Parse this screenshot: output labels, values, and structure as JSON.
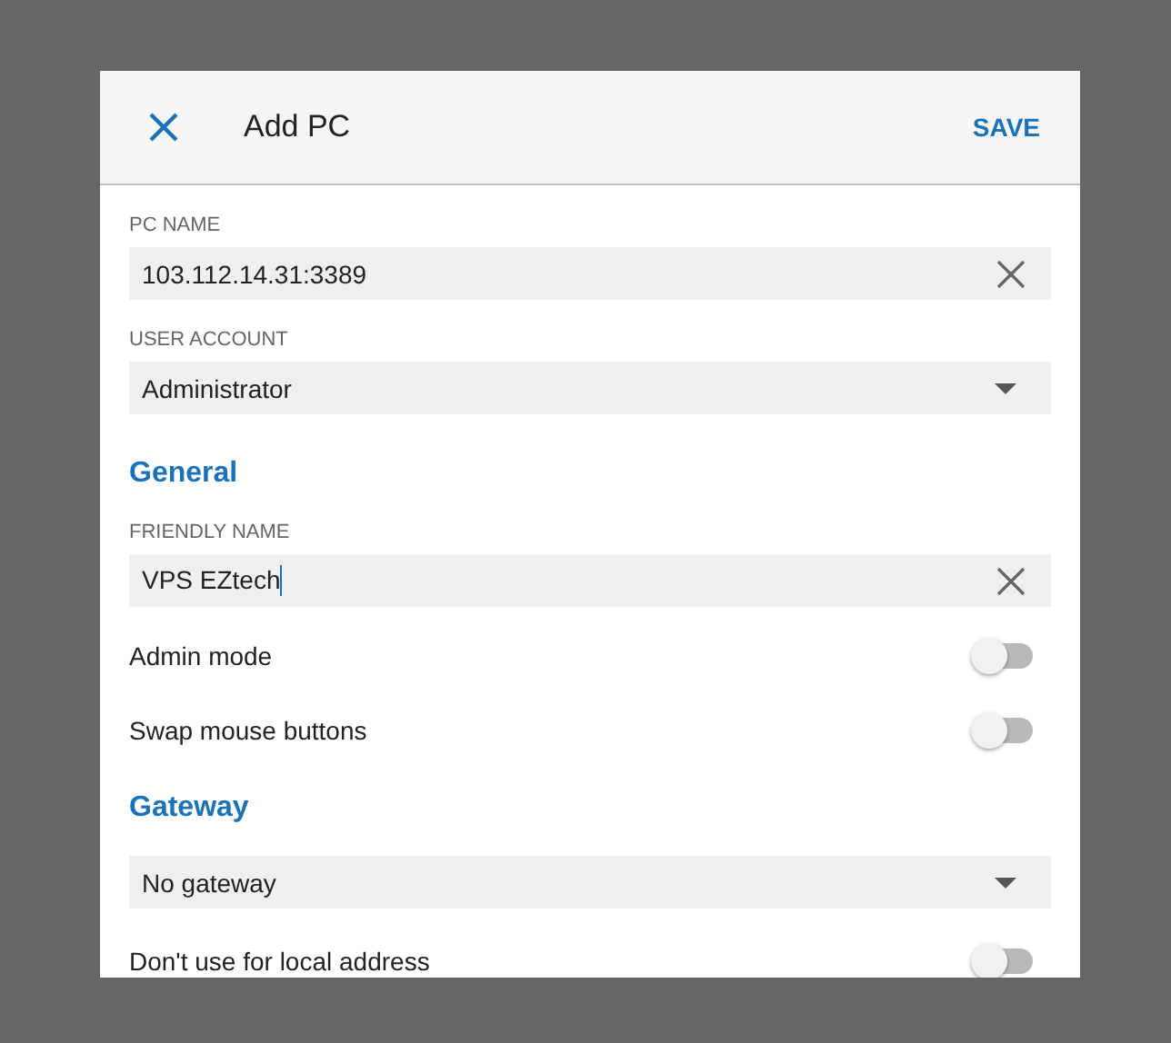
{
  "dialog": {
    "title": "Add PC",
    "save": "SAVE"
  },
  "items": [
    {
      "kind": "field",
      "label": "PC NAME",
      "value": "103.112.14.31:3389",
      "focused": false
    },
    {
      "kind": "dropdown",
      "label": "USER ACCOUNT",
      "value": "Administrator"
    },
    {
      "kind": "heading",
      "text": "General"
    },
    {
      "kind": "field",
      "label": "FRIENDLY NAME",
      "value": "VPS EZtech",
      "focused": true
    },
    {
      "kind": "toggle",
      "label": "Admin mode",
      "on": false
    },
    {
      "kind": "toggle",
      "label": "Swap mouse buttons",
      "on": false
    },
    {
      "kind": "heading",
      "text": "Gateway"
    },
    {
      "kind": "dropdown",
      "value": "No gateway"
    },
    {
      "kind": "toggle",
      "label": "Don't use for local address",
      "on": false
    }
  ]
}
